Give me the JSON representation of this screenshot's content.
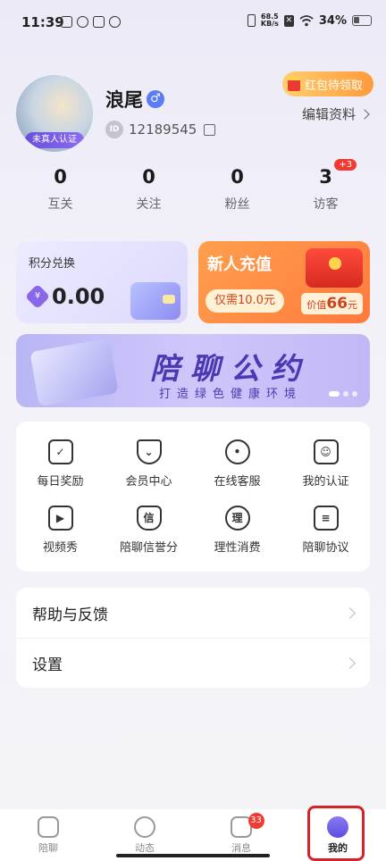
{
  "status_bar": {
    "time": "11:39",
    "net_speed_value": "68.5",
    "net_speed_unit": "KB/s",
    "battery": "34%"
  },
  "profile": {
    "avatar_badge": "未真人认证",
    "nickname": "浪尾",
    "id_label": "ID",
    "id_number": "12189545",
    "red_packet": "红包待领取",
    "edit_profile": "编辑资料"
  },
  "stats": [
    {
      "value": "0",
      "label": "互关"
    },
    {
      "value": "0",
      "label": "关注"
    },
    {
      "value": "0",
      "label": "粉丝"
    },
    {
      "value": "3",
      "label": "访客",
      "badge": "+3"
    }
  ],
  "points_card": {
    "title": "积分兑换",
    "value": "0.00"
  },
  "recharge_card": {
    "title": "新人充值",
    "price": "仅需10.0元",
    "worth_prefix": "价值",
    "worth_amount": "66",
    "worth_unit": "元"
  },
  "banner": {
    "title": "陪聊公约",
    "subtitle": "打造绿色健康环境"
  },
  "features": [
    {
      "label": "每日奖励",
      "icon": "clipboard-check-icon"
    },
    {
      "label": "会员中心",
      "icon": "diamond-icon"
    },
    {
      "label": "在线客服",
      "icon": "headset-icon"
    },
    {
      "label": "我的认证",
      "icon": "id-card-icon"
    },
    {
      "label": "视频秀",
      "icon": "video-play-icon"
    },
    {
      "label": "陪聊信誉分",
      "icon": "shield-credit-icon",
      "glyph": "信"
    },
    {
      "label": "理性消费",
      "icon": "rational-consume-icon",
      "glyph": "理"
    },
    {
      "label": "陪聊协议",
      "icon": "agreement-doc-icon"
    }
  ],
  "list": [
    {
      "label": "帮助与反馈"
    },
    {
      "label": "设置"
    }
  ],
  "bottom_nav": [
    {
      "label": "陪聊",
      "icon": "heart-chat-icon"
    },
    {
      "label": "动态",
      "icon": "planet-icon"
    },
    {
      "label": "消息",
      "icon": "message-icon",
      "badge": "33"
    },
    {
      "label": "我的",
      "icon": "profile-avatar-icon",
      "active": true
    }
  ],
  "colors": {
    "accent": "#5b4de0",
    "badge_red": "#ef3b33",
    "highlight_frame": "#d6232b"
  }
}
